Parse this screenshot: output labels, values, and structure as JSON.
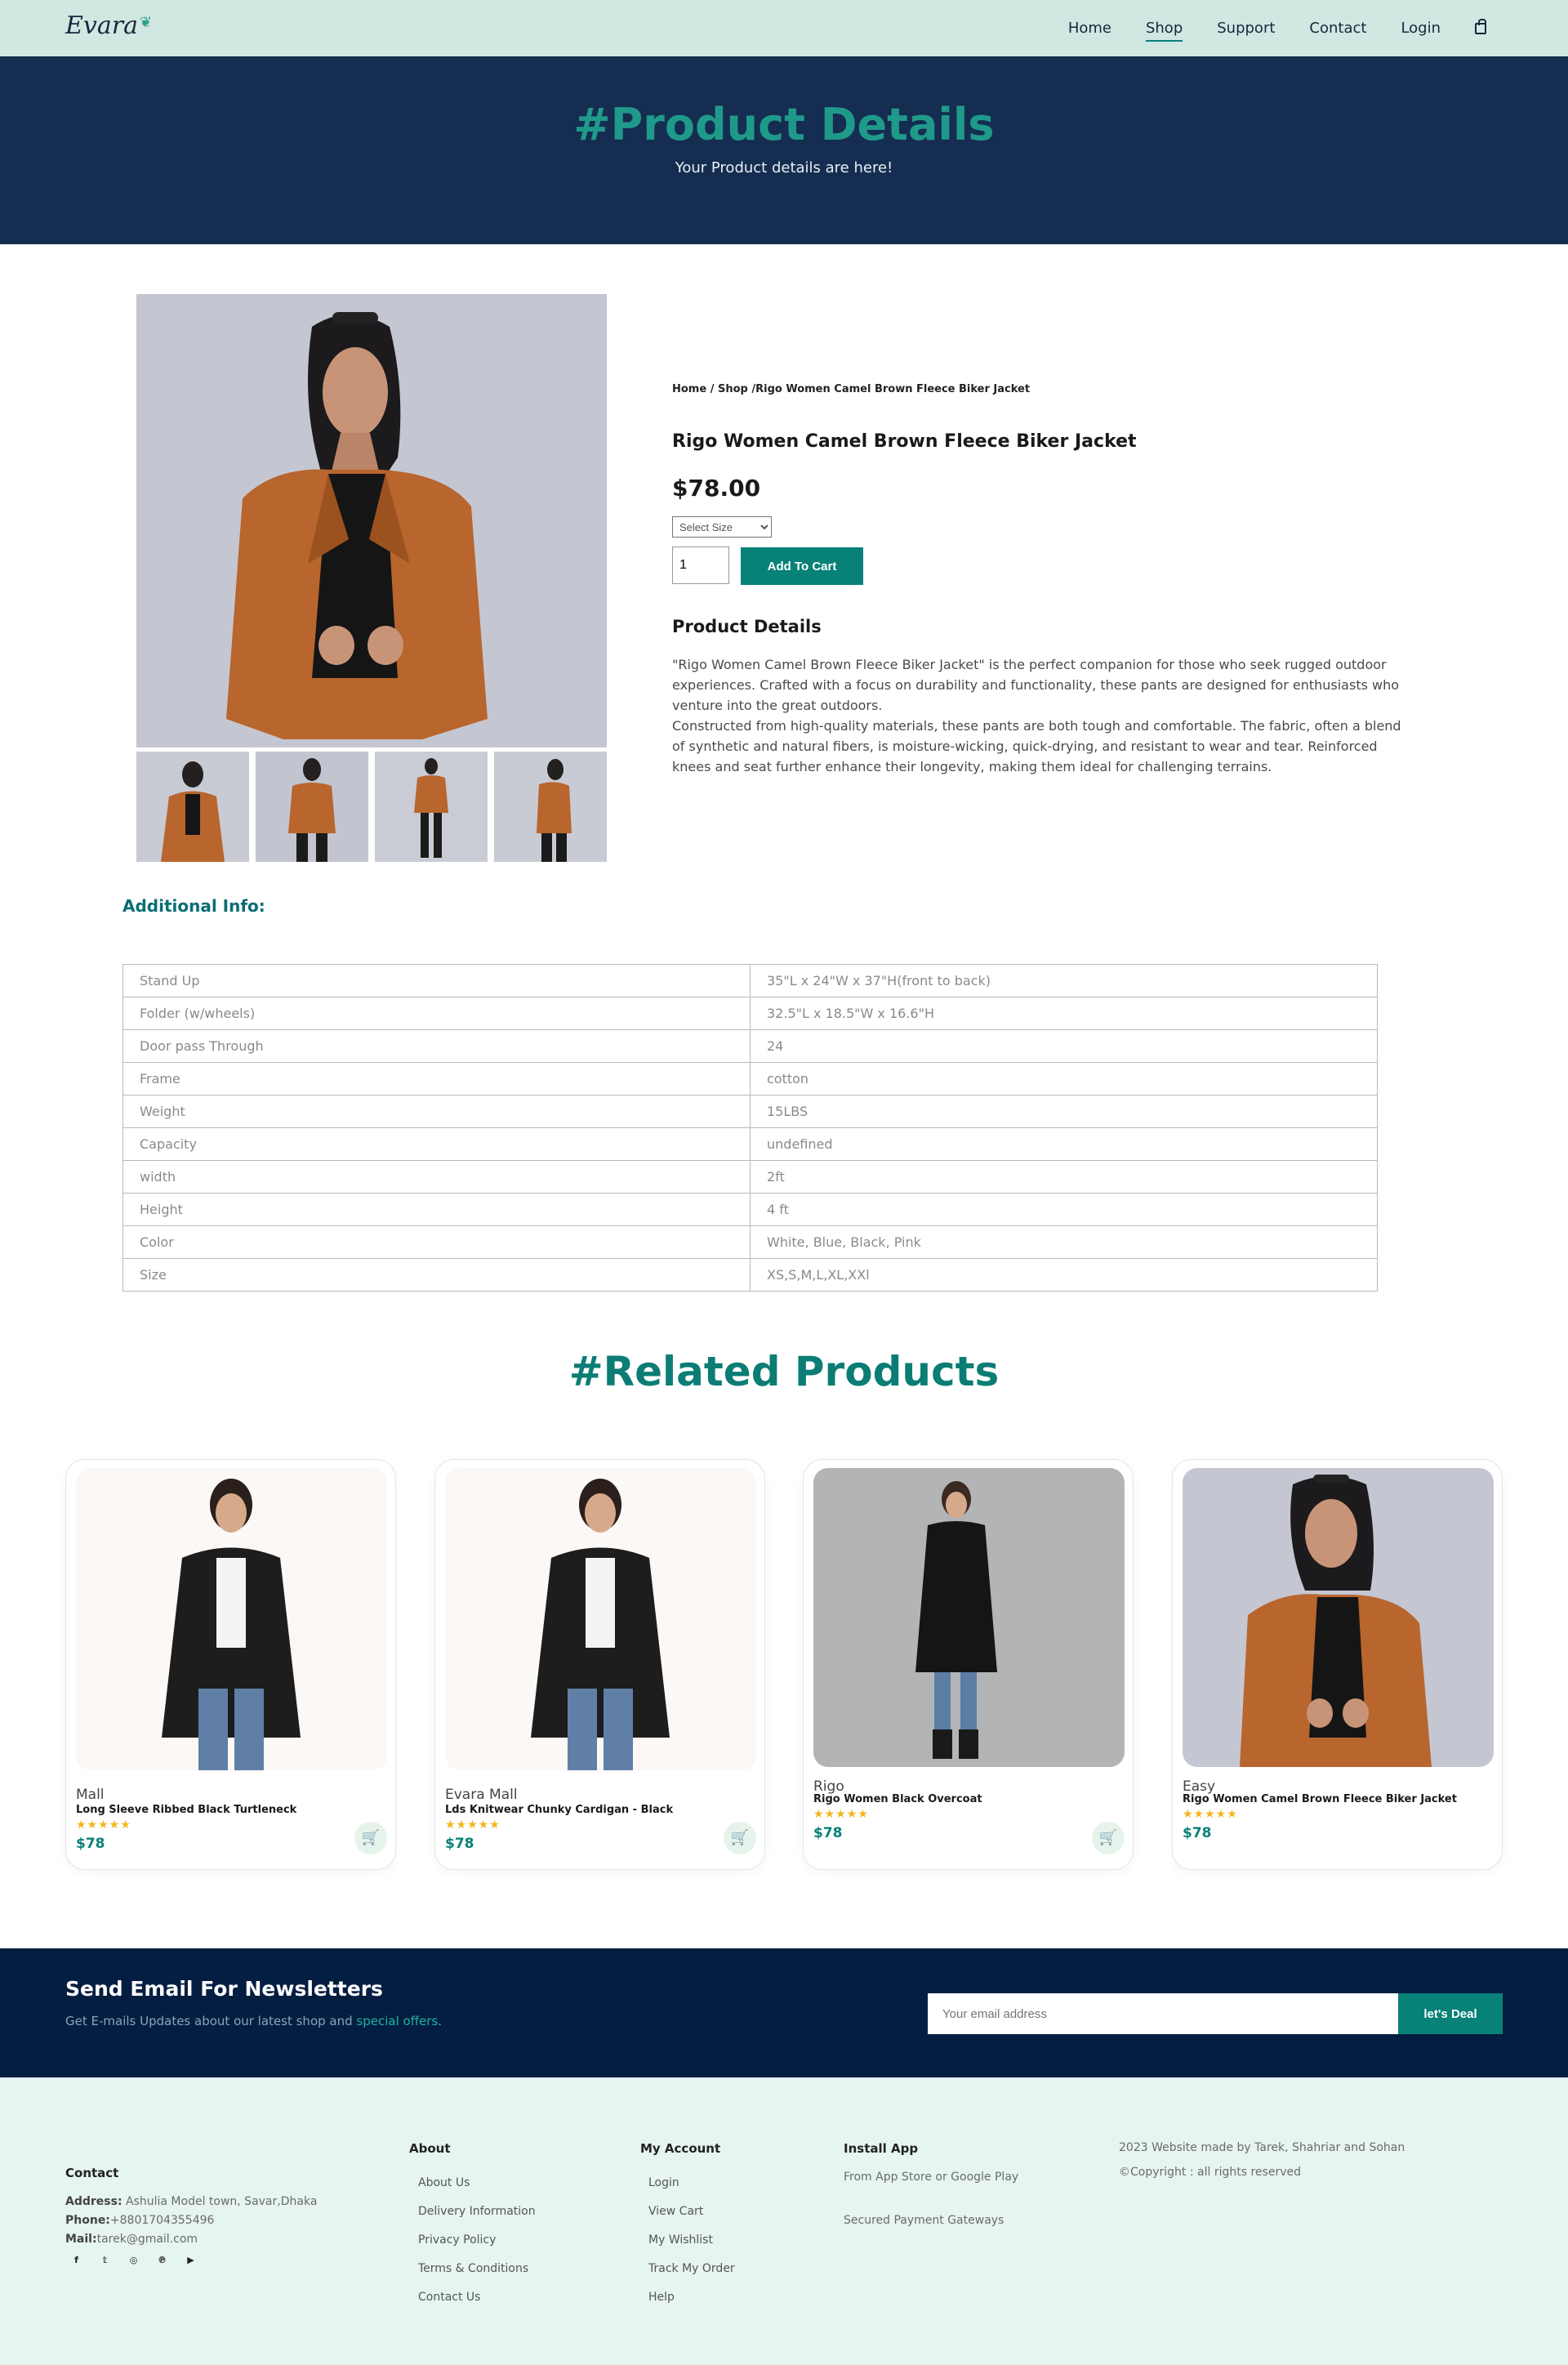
{
  "nav": {
    "logo": "Evara",
    "links": [
      "Home",
      "Shop",
      "Support",
      "Contact",
      "Login"
    ],
    "active": "Shop",
    "cart_icon": "shopping-bag-icon"
  },
  "hero": {
    "title": "#Product Details",
    "subtitle": "Your Product details are here!"
  },
  "product": {
    "breadcrumb": "Home / Shop /Rigo Women Camel Brown Fleece Biker Jacket",
    "title": "Rigo Women Camel Brown Fleece Biker Jacket",
    "price": "$78.00",
    "size_select": "Select Size",
    "quantity": "1",
    "add_to_cart": "Add To Cart",
    "details_heading": "Product Details",
    "details_p1": "\"Rigo Women Camel Brown Fleece Biker Jacket\" is the perfect companion for those who seek rugged outdoor experiences. Crafted with a focus on durability and functionality, these pants are designed for enthusiasts who venture into the great outdoors.",
    "details_p2": "Constructed from high-quality materials, these pants are both tough and comfortable. The fabric, often a blend of synthetic and natural fibers, is moisture-wicking, quick-drying, and resistant to wear and tear. Reinforced knees and seat further enhance their longevity, making them ideal for challenging terrains."
  },
  "additional": {
    "heading": "Additional Info:",
    "rows": [
      {
        "label": "Stand Up",
        "value": "35\"L x 24\"W x 37\"H(front to back)"
      },
      {
        "label": "Folder (w/wheels)",
        "value": "32.5\"L x 18.5\"W x 16.6\"H"
      },
      {
        "label": "Door pass Through",
        "value": "24"
      },
      {
        "label": "Frame",
        "value": "cotton"
      },
      {
        "label": "Weight",
        "value": "15LBS"
      },
      {
        "label": "Capacity",
        "value": "undefined"
      },
      {
        "label": "width",
        "value": "2ft"
      },
      {
        "label": "Height",
        "value": "4 ft"
      },
      {
        "label": "Color",
        "value": "White, Blue, Black, Pink"
      },
      {
        "label": "Size",
        "value": "XS,S,M,L,XL,XXl"
      }
    ]
  },
  "related": {
    "title": "#Related Products",
    "items": [
      {
        "brand": "Mall",
        "name": "Long Sleeve Ribbed Black Turtleneck",
        "stars": "★★★★★",
        "price": "$78"
      },
      {
        "brand": "Evara Mall",
        "name": "Lds Knitwear Chunky Cardigan - Black",
        "stars": "★★★★★",
        "price": "$78"
      },
      {
        "brand": "Rigo",
        "name": "Rigo Women Black Overcoat",
        "stars": "★★★★★",
        "price": "$78"
      },
      {
        "brand": "Easy",
        "name": "Rigo Women Camel Brown Fleece Biker Jacket",
        "stars": "★★★★★",
        "price": "$78"
      }
    ]
  },
  "newsletter": {
    "title": "Send Email For Newsletters",
    "sub_prefix": "Get E-mails Updates about our latest shop and ",
    "sub_highlight": "special offers",
    "sub_suffix": ".",
    "placeholder": "Your email address",
    "button": "let's Deal"
  },
  "footer": {
    "contact_heading": "Contact",
    "address_label": "Address:",
    "address": " Ashulia Model town, Savar,Dhaka",
    "phone_label": "Phone:",
    "phone": "+8801704355496",
    "mail_label": "Mail:",
    "mail": "tarek@gmail.com",
    "about_heading": "About",
    "about_links": [
      "About Us",
      "Delivery Information",
      "Privacy Policy",
      "Terms & Conditions",
      "Contact Us"
    ],
    "account_heading": "My Account",
    "account_links": [
      "Login",
      "View Cart",
      "My Wishlist",
      "Track My Order",
      "Help"
    ],
    "app_heading": "Install App",
    "app_line1": "From App Store or Google Play",
    "app_line2": "Secured Payment Gateways",
    "credit": "2023 Website made by Tarek, Shahriar and Sohan",
    "copyright": "©Copyright : all rights reserved",
    "socials": [
      "facebook-icon",
      "twitter-icon",
      "instagram-icon",
      "pinterest-icon",
      "youtube-icon"
    ]
  },
  "colors": {
    "accent": "#088178",
    "hero_bg": "#152d50",
    "nav_bg": "#d1e7e1",
    "newsletter_bg": "#041e42",
    "footer_bg": "#e6f4f2"
  }
}
